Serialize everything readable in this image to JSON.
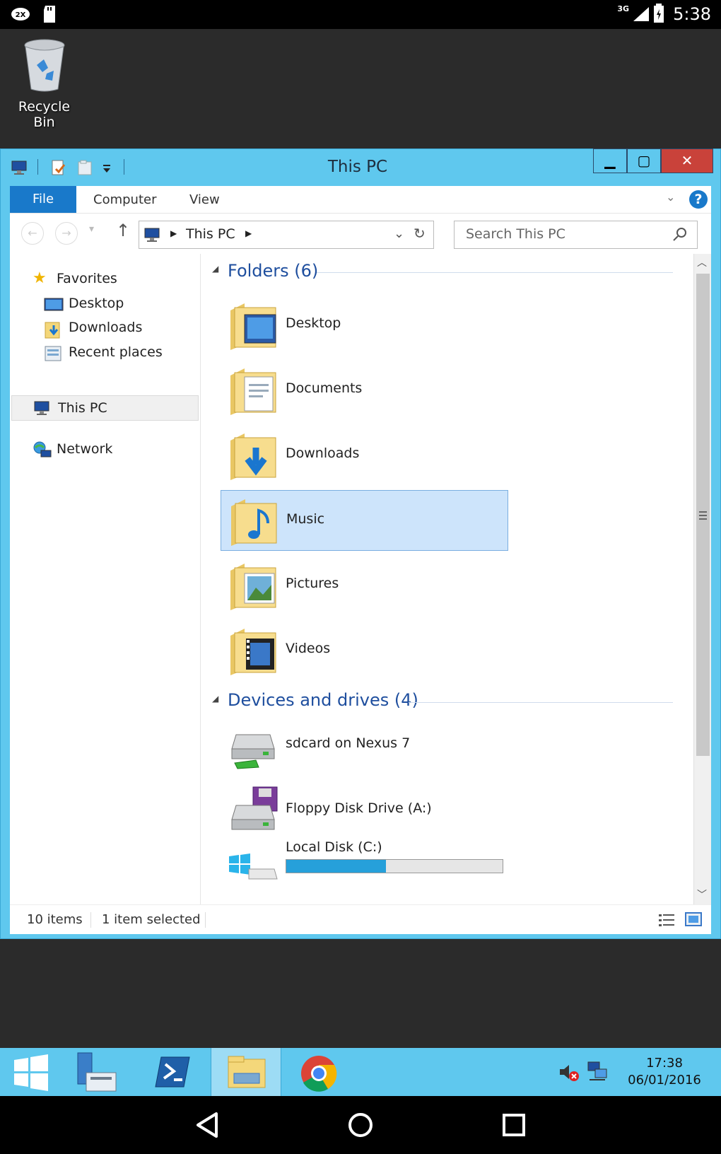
{
  "android_status": {
    "network": "3G",
    "time": "5:38"
  },
  "desktop": {
    "recycle_bin_label": "Recycle Bin"
  },
  "window": {
    "title": "This PC",
    "ribbon": {
      "file": "File",
      "computer": "Computer",
      "view": "View"
    },
    "address": {
      "path_label": "This PC"
    },
    "search": {
      "placeholder": "Search This PC"
    },
    "nav_pane": {
      "favorites": "Favorites",
      "desktop": "Desktop",
      "downloads": "Downloads",
      "recent_places": "Recent places",
      "this_pc": "This PC",
      "network": "Network"
    },
    "folders_group": "Folders (6)",
    "folders": [
      {
        "label": "Desktop"
      },
      {
        "label": "Documents"
      },
      {
        "label": "Downloads"
      },
      {
        "label": "Music"
      },
      {
        "label": "Pictures"
      },
      {
        "label": "Videos"
      }
    ],
    "devices_group": "Devices and drives (4)",
    "devices": [
      {
        "label": "sdcard on Nexus 7"
      },
      {
        "label": "Floppy Disk Drive (A:)"
      },
      {
        "label": "Local Disk (C:)",
        "used_fraction": 0.46
      }
    ],
    "status": {
      "count": "10 items",
      "selection": "1 item selected"
    }
  },
  "taskbar": {
    "clock_time": "17:38",
    "clock_date": "06/01/2016"
  },
  "colors": {
    "window_frame": "#5fc8ee",
    "accent": "#1979ca",
    "close": "#c9423a",
    "selection": "#cde4fb"
  }
}
